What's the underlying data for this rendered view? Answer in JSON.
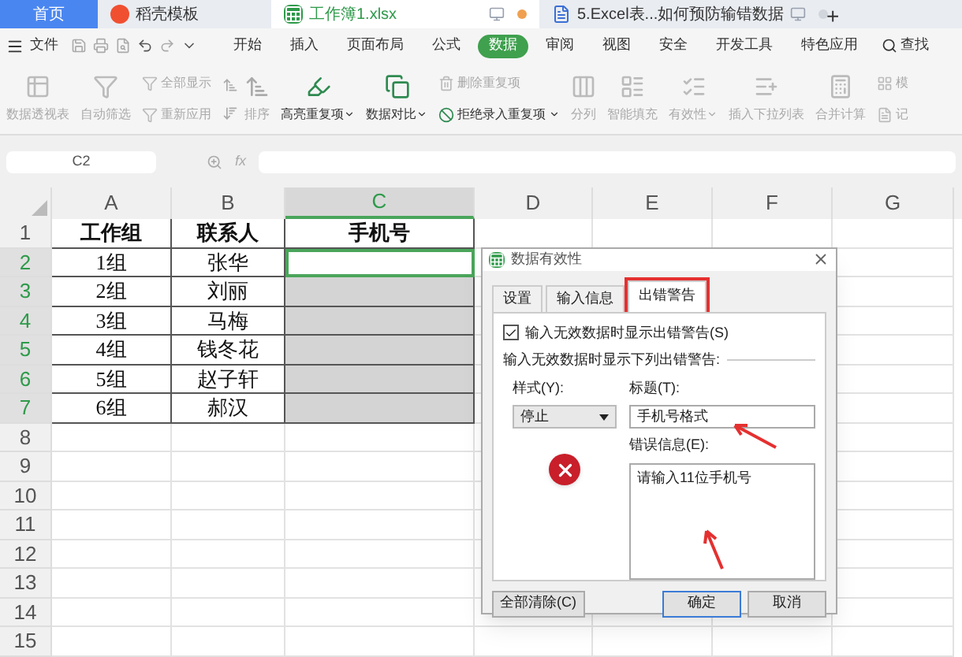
{
  "doc_tabs": [
    {
      "label": "首页",
      "kind": "home",
      "selected": false
    },
    {
      "label": "稻壳模板",
      "kind": "template",
      "selected": false
    },
    {
      "label": "工作簿1.xlsx",
      "kind": "sheet",
      "selected": true
    },
    {
      "label": "5.Excel表...如何预防输错数据",
      "kind": "word",
      "selected": false
    }
  ],
  "new_tab": "+",
  "menu": {
    "file": "文件",
    "tabs": [
      {
        "label": "开始",
        "selected": false
      },
      {
        "label": "插入",
        "selected": false
      },
      {
        "label": "页面布局",
        "selected": false
      },
      {
        "label": "公式",
        "selected": false
      },
      {
        "label": "数据",
        "selected": true
      },
      {
        "label": "审阅",
        "selected": false
      },
      {
        "label": "视图",
        "selected": false
      },
      {
        "label": "安全",
        "selected": false
      },
      {
        "label": "开发工具",
        "selected": false
      },
      {
        "label": "特色应用",
        "selected": false
      }
    ],
    "search": "查找"
  },
  "ribbon": [
    {
      "kind": "big",
      "label": "数据透视表",
      "disabled": true,
      "dropdown": false
    },
    {
      "kind": "big",
      "label": "自动筛选",
      "disabled": true,
      "dropdown": false
    },
    {
      "kind": "pair",
      "items": [
        {
          "label": "全部显示",
          "disabled": true,
          "dropdown": false
        },
        {
          "label": "重新应用",
          "disabled": true,
          "dropdown": false
        }
      ]
    },
    {
      "kind": "sort",
      "label": "排序",
      "disabled": true
    },
    {
      "kind": "big",
      "label": "高亮重复项",
      "disabled": false,
      "dropdown": true
    },
    {
      "kind": "big",
      "label": "数据对比",
      "disabled": false,
      "dropdown": true
    },
    {
      "kind": "pair",
      "items": [
        {
          "label": "删除重复项",
          "disabled": true,
          "dropdown": false
        },
        {
          "label": "拒绝录入重复项",
          "disabled": false,
          "dropdown": true
        }
      ]
    },
    {
      "kind": "big",
      "label": "分列",
      "disabled": true,
      "dropdown": false
    },
    {
      "kind": "big",
      "label": "智能填充",
      "disabled": true,
      "dropdown": false
    },
    {
      "kind": "big",
      "label": "有效性",
      "disabled": true,
      "dropdown": true
    },
    {
      "kind": "big",
      "label": "插入下拉列表",
      "disabled": true,
      "dropdown": false
    },
    {
      "kind": "big",
      "label": "合并计算",
      "disabled": true,
      "dropdown": false
    },
    {
      "kind": "pair",
      "items": [
        {
          "label": "模",
          "disabled": true,
          "dropdown": false
        },
        {
          "label": "记",
          "disabled": true,
          "dropdown": false
        }
      ]
    }
  ],
  "name_box": "C2",
  "fx": "fx",
  "sheet": {
    "columns": [
      {
        "label": "A",
        "selected": false
      },
      {
        "label": "B",
        "selected": false
      },
      {
        "label": "C",
        "selected": true
      },
      {
        "label": "D",
        "selected": false
      },
      {
        "label": "E",
        "selected": false
      },
      {
        "label": "F",
        "selected": false
      },
      {
        "label": "G",
        "selected": false
      }
    ],
    "rows": [
      {
        "num": "1",
        "selected": false,
        "cells": [
          "工作组",
          "联系人",
          "手机号"
        ],
        "header": true
      },
      {
        "num": "2",
        "selected": true,
        "cells": [
          "1组",
          "张华",
          ""
        ]
      },
      {
        "num": "3",
        "selected": true,
        "cells": [
          "2组",
          "刘丽",
          ""
        ]
      },
      {
        "num": "4",
        "selected": true,
        "cells": [
          "3组",
          "马梅",
          ""
        ]
      },
      {
        "num": "5",
        "selected": true,
        "cells": [
          "4组",
          "钱冬花",
          ""
        ]
      },
      {
        "num": "6",
        "selected": true,
        "cells": [
          "5组",
          "赵子轩",
          ""
        ]
      },
      {
        "num": "7",
        "selected": true,
        "cells": [
          "6组",
          "郝汉",
          ""
        ]
      },
      {
        "num": "8",
        "selected": false,
        "cells": []
      },
      {
        "num": "9",
        "selected": false,
        "cells": []
      },
      {
        "num": "10",
        "selected": false,
        "cells": []
      },
      {
        "num": "11",
        "selected": false,
        "cells": []
      },
      {
        "num": "12",
        "selected": false,
        "cells": []
      },
      {
        "num": "13",
        "selected": false,
        "cells": []
      },
      {
        "num": "14",
        "selected": false,
        "cells": []
      },
      {
        "num": "15",
        "selected": false,
        "cells": []
      }
    ]
  },
  "dialog": {
    "title": "数据有效性",
    "tabs": [
      {
        "label": "设置",
        "selected": false
      },
      {
        "label": "输入信息",
        "selected": false
      },
      {
        "label": "出错警告",
        "selected": true
      }
    ],
    "show_error": {
      "label": "输入无效数据时显示出错警告(S)",
      "checked": true
    },
    "section": "输入无效数据时显示下列出错警告:",
    "style_label": "样式(Y):",
    "style_value": "停止",
    "title_label": "标题(T):",
    "title_value": "手机号格式",
    "message_label": "错误信息(E):",
    "message_value": "请输入11位手机号",
    "clear_button": "全部清除(C)",
    "ok_button": "确定",
    "cancel_button": "取消"
  }
}
